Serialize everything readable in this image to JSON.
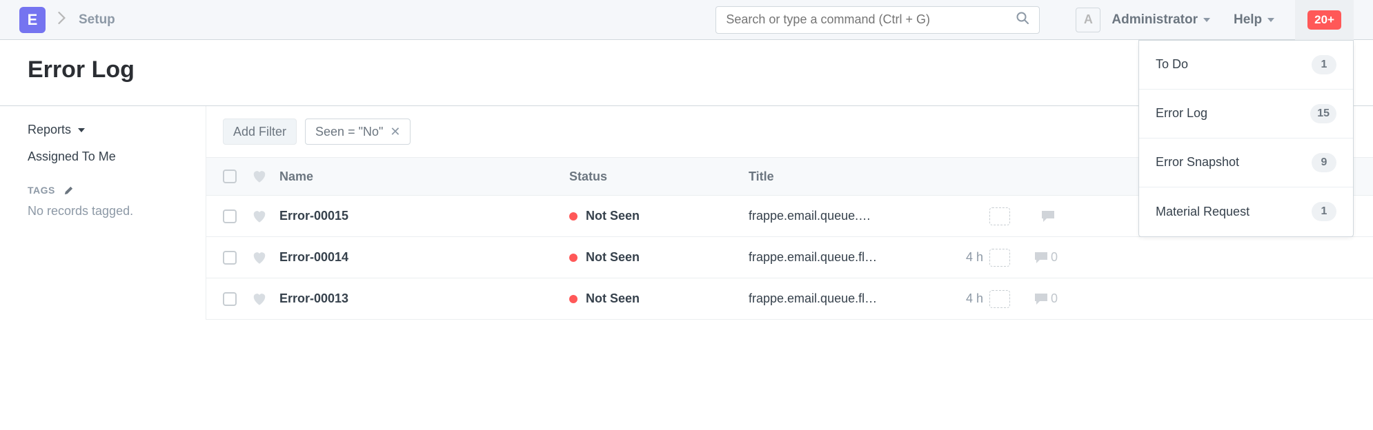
{
  "navbar": {
    "brand_letter": "E",
    "breadcrumb": "Setup",
    "search_placeholder": "Search or type a command (Ctrl + G)",
    "avatar_letter": "A",
    "user_label": "Administrator",
    "help_label": "Help",
    "notif_count": "20+"
  },
  "notif_dropdown": {
    "items": [
      {
        "label": "To Do",
        "count": "1"
      },
      {
        "label": "Error Log",
        "count": "15"
      },
      {
        "label": "Error Snapshot",
        "count": "9"
      },
      {
        "label": "Material Request",
        "count": "1"
      }
    ]
  },
  "page": {
    "title": "Error Log"
  },
  "sidebar": {
    "reports_label": "Reports",
    "assigned_label": "Assigned To Me",
    "tags_label": "TAGS",
    "no_tags": "No records tagged."
  },
  "filters": {
    "add_label": "Add Filter",
    "seen_filter": "Seen = \"No\""
  },
  "columns": {
    "name": "Name",
    "status": "Status",
    "title": "Title"
  },
  "rows": [
    {
      "name": "Error-00015",
      "status": "Not Seen",
      "title": "frappe.email.queue.…",
      "time": "",
      "comments": ""
    },
    {
      "name": "Error-00014",
      "status": "Not Seen",
      "title": "frappe.email.queue.fl…",
      "time": "4 h",
      "comments": "0"
    },
    {
      "name": "Error-00013",
      "status": "Not Seen",
      "title": "frappe.email.queue.fl…",
      "time": "4 h",
      "comments": "0"
    }
  ]
}
